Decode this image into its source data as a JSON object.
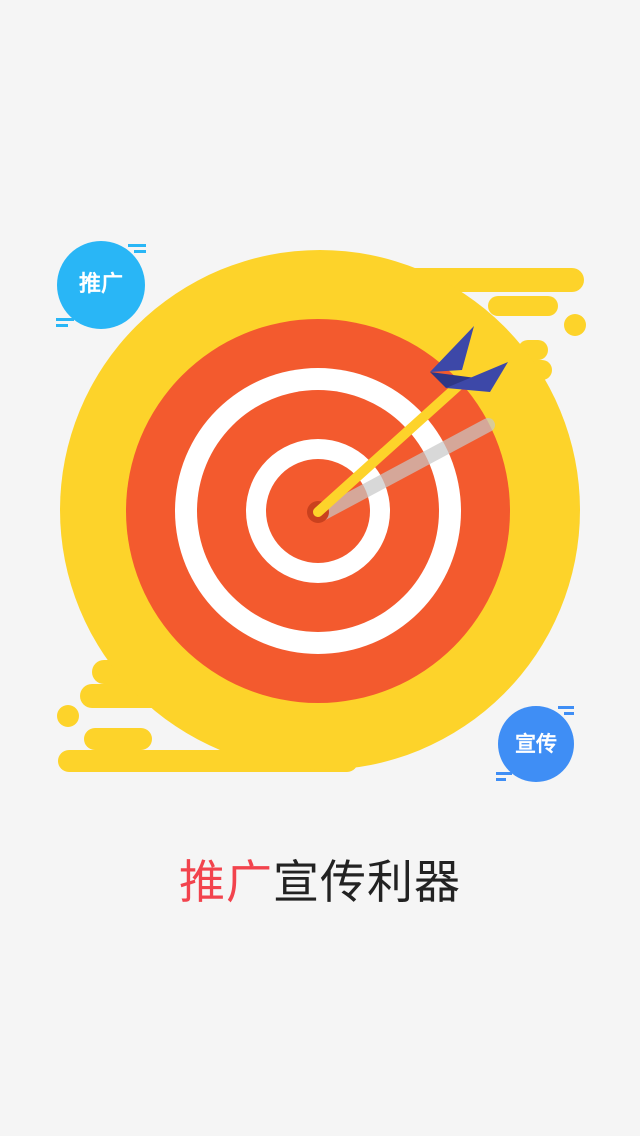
{
  "illustration": {
    "name": "target-with-arrow",
    "colors": {
      "yellow": "#fdd32a",
      "red": "#f35a2e",
      "white": "#ffffff",
      "arrow_shaft": "#fdd32a",
      "arrow_fletching": "#3d48a8",
      "shadow": "#c7c7c7"
    }
  },
  "bubbles": {
    "promote": {
      "label": "推广",
      "color": "#29b6f6"
    },
    "publicity": {
      "label": "宣传",
      "color": "#3f8ef5"
    }
  },
  "tagline": {
    "accent_text": "推广",
    "rest_text": "宣传利器",
    "accent_color": "#f2434d"
  }
}
